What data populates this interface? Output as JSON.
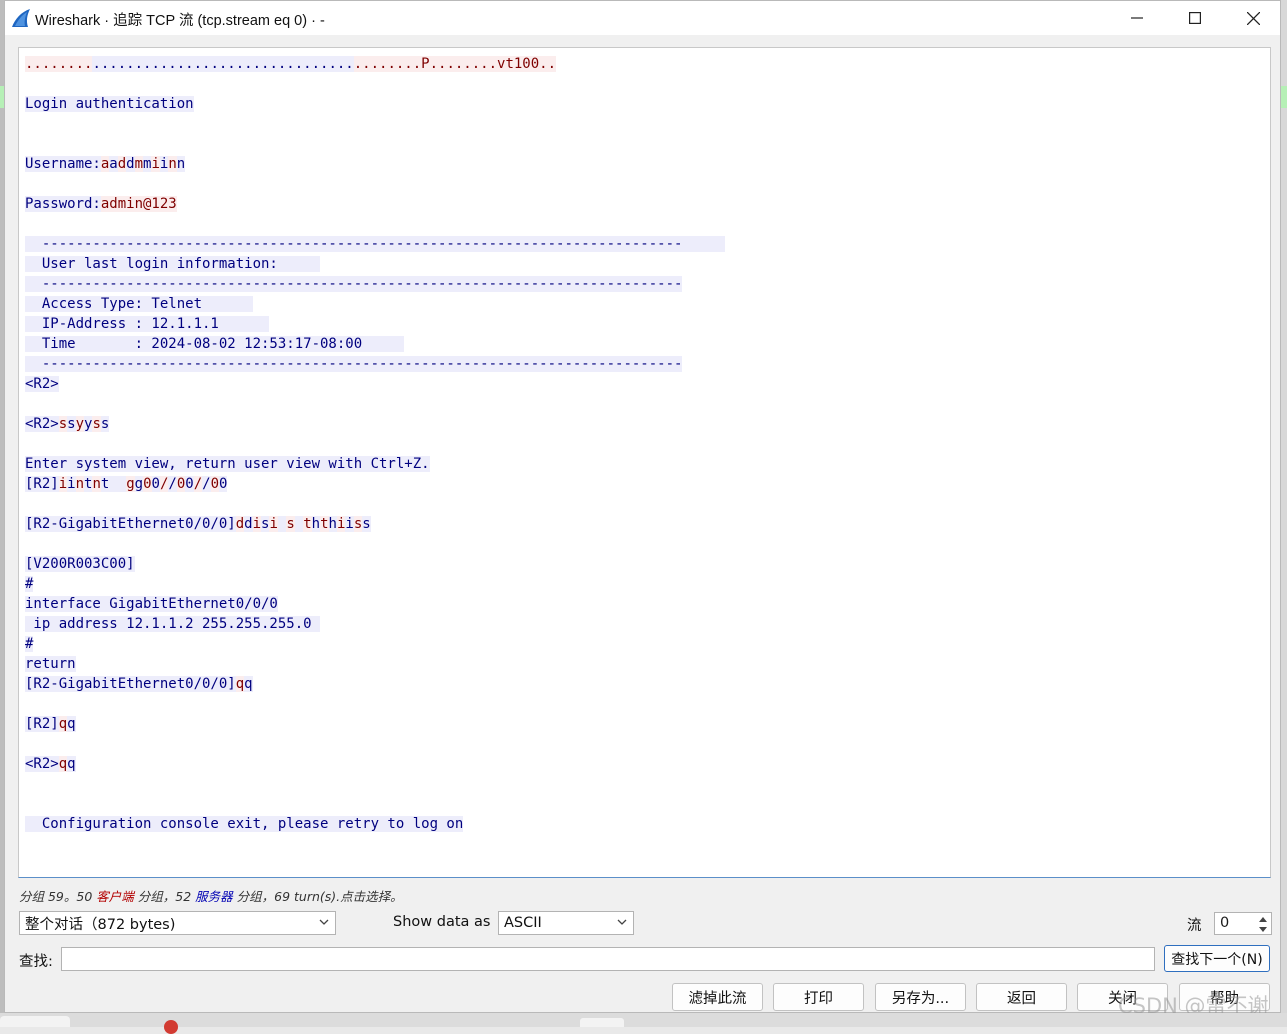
{
  "window": {
    "title": "Wireshark · 追踪 TCP 流 (tcp.stream eq 0) · -",
    "icons": {
      "app": "wireshark-fin-icon",
      "minimize": "minimize-icon",
      "maximize": "maximize-icon",
      "close": "close-icon"
    }
  },
  "stream": {
    "colors": {
      "client_bg": "#fbeded",
      "client_fg": "#7f0000",
      "server_bg": "#ededfb",
      "server_fg": "#00007f"
    },
    "lines": [
      [
        [
          "c",
          "........"
        ],
        [
          "s",
          "..............................."
        ],
        [
          "c",
          "........P........vt100.."
        ]
      ],
      [],
      [
        [
          "s",
          "Login authentication"
        ]
      ],
      [],
      [],
      [
        [
          "s",
          "Username:"
        ],
        [
          "c",
          "a"
        ],
        [
          "s",
          "a"
        ],
        [
          "c",
          "d"
        ],
        [
          "s",
          "d"
        ],
        [
          "c",
          "m"
        ],
        [
          "s",
          "m"
        ],
        [
          "c",
          "i"
        ],
        [
          "s",
          "i"
        ],
        [
          "c",
          "n"
        ],
        [
          "s",
          "n"
        ]
      ],
      [],
      [
        [
          "s",
          "Password:"
        ],
        [
          "c",
          "admin@123"
        ]
      ],
      [],
      [
        [
          "s",
          "  ----------------------------------------------------------------------------     "
        ]
      ],
      [
        [
          "s",
          "  User last login information:     "
        ]
      ],
      [
        [
          "s",
          "  ----------------------------------------------------------------------------"
        ]
      ],
      [
        [
          "s",
          "  Access Type: Telnet      "
        ]
      ],
      [
        [
          "s",
          "  IP-Address : 12.1.1.1      "
        ]
      ],
      [
        [
          "s",
          "  Time       : 2024-08-02 12:53:17-08:00     "
        ]
      ],
      [
        [
          "s",
          "  ----------------------------------------------------------------------------"
        ]
      ],
      [
        [
          "s",
          "<R2>"
        ]
      ],
      [],
      [
        [
          "s",
          "<R2>"
        ],
        [
          "c",
          "s"
        ],
        [
          "s",
          "s"
        ],
        [
          "c",
          "y"
        ],
        [
          "s",
          "y"
        ],
        [
          "c",
          "s"
        ],
        [
          "s",
          "s"
        ]
      ],
      [],
      [
        [
          "s",
          "Enter system view, return user view with Ctrl+Z."
        ]
      ],
      [
        [
          "s",
          "[R2]"
        ],
        [
          "c",
          "i"
        ],
        [
          "s",
          "i"
        ],
        [
          "c",
          "n"
        ],
        [
          "s",
          "t"
        ],
        [
          "c",
          "n"
        ],
        [
          "s",
          "t  "
        ],
        [
          "c",
          "g"
        ],
        [
          "s",
          "g"
        ],
        [
          "c",
          "0"
        ],
        [
          "s",
          "0"
        ],
        [
          "c",
          "/"
        ],
        [
          "s",
          "/"
        ],
        [
          "c",
          "0"
        ],
        [
          "s",
          "0"
        ],
        [
          "c",
          "/"
        ],
        [
          "s",
          "/"
        ],
        [
          "c",
          "0"
        ],
        [
          "s",
          "0"
        ]
      ],
      [],
      [
        [
          "s",
          "[R2-GigabitEthernet0/0/0]"
        ],
        [
          "c",
          "d"
        ],
        [
          "s",
          "d"
        ],
        [
          "c",
          "i"
        ],
        [
          "s",
          "s"
        ],
        [
          "c",
          "i"
        ],
        [
          "s",
          " "
        ],
        [
          "c",
          "s"
        ],
        [
          "s",
          " "
        ],
        [
          "c",
          "t"
        ],
        [
          "s",
          "h"
        ],
        [
          "c",
          "t"
        ],
        [
          "s",
          "h"
        ],
        [
          "c",
          "i"
        ],
        [
          "s",
          "i"
        ],
        [
          "c",
          "s"
        ],
        [
          "s",
          "s"
        ]
      ],
      [],
      [
        [
          "s",
          "[V200R003C00]"
        ]
      ],
      [
        [
          "s",
          "#"
        ]
      ],
      [
        [
          "s",
          "interface GigabitEthernet0/0/0"
        ]
      ],
      [
        [
          "s",
          " ip address 12.1.1.2 255.255.255.0 "
        ]
      ],
      [
        [
          "s",
          "#"
        ]
      ],
      [
        [
          "s",
          "return"
        ]
      ],
      [
        [
          "s",
          "[R2-GigabitEthernet0/0/0]"
        ],
        [
          "c",
          "q"
        ],
        [
          "s",
          "q"
        ]
      ],
      [],
      [
        [
          "s",
          "[R2]"
        ],
        [
          "c",
          "q"
        ],
        [
          "s",
          "q"
        ]
      ],
      [],
      [
        [
          "s",
          "<R2>"
        ],
        [
          "c",
          "q"
        ],
        [
          "s",
          "q"
        ]
      ],
      [],
      [],
      [
        [
          "s",
          "  Configuration console exit, please retry to log on"
        ]
      ]
    ]
  },
  "status": {
    "p1": "分组 59。50 ",
    "client": "客户端",
    "p2": " 分组，52 ",
    "server": "服务器",
    "p3": " 分组，69 turn(s).点击选择。"
  },
  "controls": {
    "conversation": "整个对话（872 bytes)",
    "show_data_label": "Show data as",
    "format": "ASCII",
    "stream_label": "流",
    "stream_value": "0",
    "find_label": "查找:",
    "find_value": "",
    "find_next": "查找下一个(N)"
  },
  "buttons": {
    "filter_out": "滤掉此流",
    "print": "打印",
    "save_as": "另存为...",
    "back": "返回",
    "close": "关闭",
    "help": "帮助"
  },
  "watermark": "CSDN @雷不谢"
}
